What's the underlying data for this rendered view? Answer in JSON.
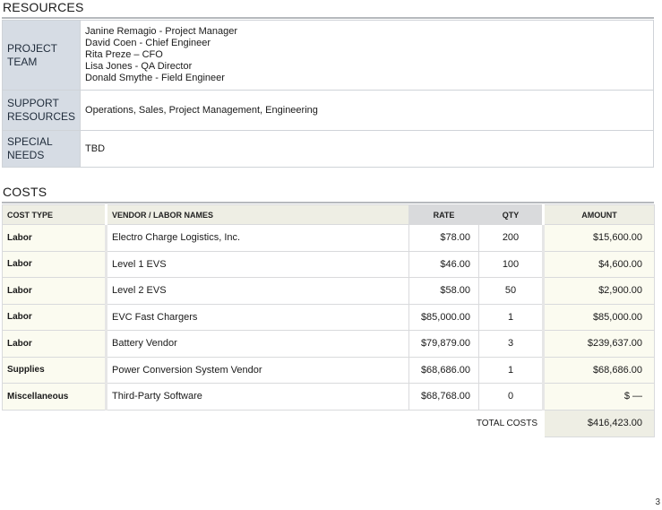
{
  "resources": {
    "title": "RESOURCES",
    "project_team": {
      "label_line1": "PROJECT",
      "label_line2": "TEAM",
      "members": [
        "Janine Remagio - Project Manager",
        "David Coen - Chief Engineer",
        "Rita Preze – CFO",
        "Lisa Jones - QA Director",
        "Donald Smythe - Field Engineer"
      ]
    },
    "support_resources": {
      "label_line1": "SUPPORT",
      "label_line2": "RESOURCES",
      "value": "Operations, Sales, Project Management, Engineering"
    },
    "special_needs": {
      "label_line1": "SPECIAL",
      "label_line2": "NEEDS",
      "value": "TBD"
    }
  },
  "costs": {
    "title": "COSTS",
    "headers": {
      "cost_type": "COST TYPE",
      "vendor": "VENDOR / LABOR NAMES",
      "rate": "RATE",
      "qty": "QTY",
      "amount": "AMOUNT"
    },
    "rows": [
      {
        "type": "Labor",
        "vendor": "Electro Charge Logistics, Inc.",
        "rate": "$78.00",
        "qty": "200",
        "amount": "$15,600.00"
      },
      {
        "type": "Labor",
        "vendor": "Level 1 EVS",
        "rate": "$46.00",
        "qty": "100",
        "amount": "$4,600.00"
      },
      {
        "type": "Labor",
        "vendor": "Level 2 EVS",
        "rate": "$58.00",
        "qty": "50",
        "amount": "$2,900.00"
      },
      {
        "type": "Labor",
        "vendor": "EVC Fast Chargers",
        "rate": "$85,000.00",
        "qty": "1",
        "amount": "$85,000.00"
      },
      {
        "type": "Labor",
        "vendor": "Battery Vendor",
        "rate": "$79,879.00",
        "qty": "3",
        "amount": "$239,637.00"
      },
      {
        "type": "Supplies",
        "vendor": "Power Conversion System Vendor",
        "rate": "$68,686.00",
        "qty": "1",
        "amount": "$68,686.00"
      },
      {
        "type": "Miscellaneous",
        "vendor": "Third-Party Software",
        "rate": "$68,768.00",
        "qty": "0",
        "amount": "$ —"
      }
    ],
    "total_label": "TOTAL COSTS",
    "total_value": "$416,423.00"
  },
  "page_number": "3"
}
